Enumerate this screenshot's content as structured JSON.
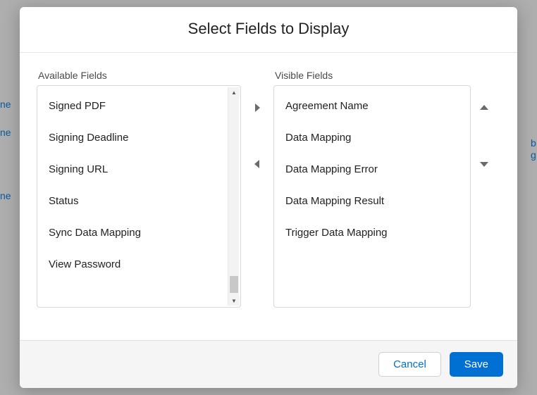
{
  "dialog": {
    "title": "Select Fields to Display"
  },
  "available": {
    "label": "Available Fields",
    "items": [
      "Signed PDF",
      "Signing Deadline",
      "Signing URL",
      "Status",
      "Sync Data Mapping",
      "View Password"
    ]
  },
  "visible": {
    "label": "Visible Fields",
    "items": [
      "Agreement Name",
      "Data Mapping",
      "Data Mapping Error",
      "Data Mapping Result",
      "Trigger Data Mapping"
    ]
  },
  "footer": {
    "cancel": "Cancel",
    "save": "Save"
  },
  "icons": {
    "move_right": "caret-right-icon",
    "move_left": "caret-left-icon",
    "move_up": "caret-up-icon",
    "move_down": "caret-down-icon"
  },
  "colors": {
    "primary": "#0070d2",
    "border": "#d8d8d8",
    "text": "#222222",
    "muted": "#4a4a4a"
  }
}
